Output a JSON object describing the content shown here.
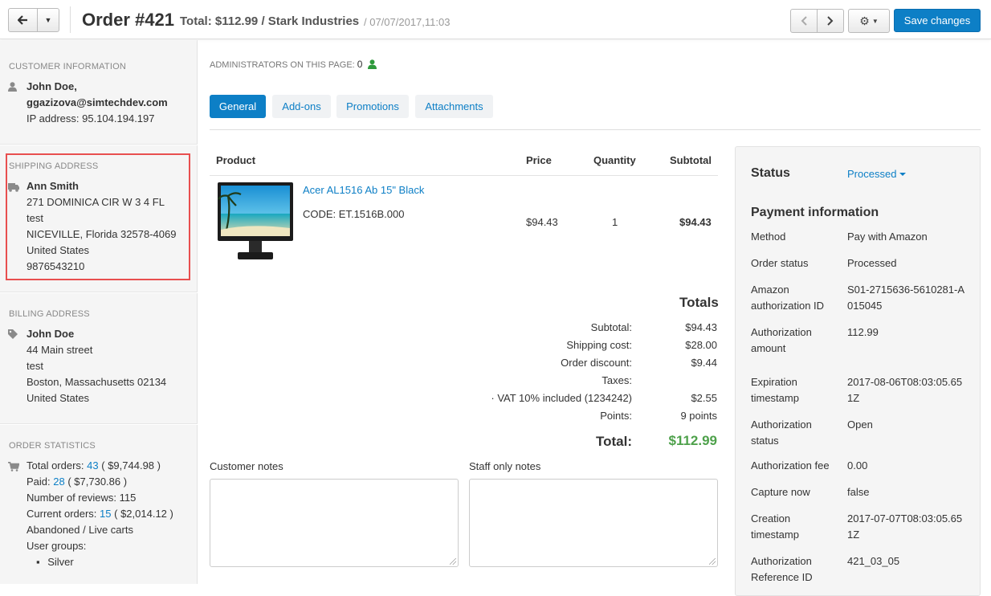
{
  "header": {
    "title": "Order #421",
    "subtitle": "Total: $112.99 / Stark Industries",
    "date": "/ 07/07/2017,11:03",
    "save_label": "Save changes"
  },
  "sidebar": {
    "customer": {
      "title": "Customer Information",
      "name": "John Doe,",
      "email": "ggazizova@simtechdev.com",
      "ip": "IP address: 95.104.194.197"
    },
    "shipping": {
      "title": "Shipping Address",
      "name": "Ann Smith",
      "line1": "271 DOMINICA CIR W 3 4 FL",
      "line2": "test",
      "line3": "NICEVILLE, Florida 32578-4069",
      "line4": "United States",
      "phone": "9876543210"
    },
    "billing": {
      "title": "Billing Address",
      "name": "John Doe",
      "line1": "44 Main street",
      "line2": "test",
      "line3": "Boston, Massachusetts 02134",
      "line4": "United States"
    },
    "stats": {
      "title": "Order Statistics",
      "total_orders_label": "Total orders:",
      "total_orders_count": "43",
      "total_orders_amount": "( $9,744.98 )",
      "paid_label": "Paid:",
      "paid_count": "28",
      "paid_amount": "( $7,730.86 )",
      "reviews": "Number of reviews: 115",
      "current_label": "Current orders:",
      "current_count": "15",
      "current_amount": "( $2,014.12 )",
      "abandoned_link": "Abandoned / Live carts",
      "user_groups_label": "User groups:",
      "user_group": "Silver"
    }
  },
  "main": {
    "admins_label": "ADMINISTRATORS ON THIS PAGE:",
    "admins_count": "0",
    "tabs": [
      "General",
      "Add-ons",
      "Promotions",
      "Attachments"
    ],
    "columns": [
      "Product",
      "Price",
      "Quantity",
      "Subtotal"
    ],
    "product": {
      "name": "Acer AL1516 Ab 15\" Black",
      "code": "CODE: ET.1516B.000",
      "price": "$94.43",
      "quantity": "1",
      "subtotal": "$94.43"
    },
    "totals": {
      "title": "Totals",
      "rows": [
        {
          "label": "Subtotal:",
          "value": "$94.43"
        },
        {
          "label": "Shipping cost:",
          "value": "$28.00"
        },
        {
          "label": "Order discount:",
          "value": "$9.44"
        },
        {
          "label": "Taxes:",
          "value": ""
        },
        {
          "label": "· VAT 10% included (1234242)",
          "value": "$2.55"
        },
        {
          "label": "Points:",
          "value": "9 points"
        }
      ],
      "total_label": "Total:",
      "total_value": "$112.99"
    },
    "customer_notes_label": "Customer notes",
    "staff_notes_label": "Staff only notes"
  },
  "panel": {
    "status_title": "Status",
    "status_value": "Processed",
    "payment_title": "Payment information",
    "rows": [
      {
        "label": "Method",
        "value": "Pay with Amazon"
      },
      {
        "label": "Order status",
        "value": "Processed"
      },
      {
        "label": "Amazon authorization ID",
        "value": "S01-2715636-5610281-A015045"
      },
      {
        "label": "Authorization amount",
        "value": "112.99"
      },
      {
        "label": "Expiration timestamp",
        "value": "2017-08-06T08:03:05.651Z"
      },
      {
        "label": "Authorization status",
        "value": "Open"
      },
      {
        "label": "Authorization fee",
        "value": "0.00"
      },
      {
        "label": "Capture now",
        "value": "false"
      },
      {
        "label": "Creation timestamp",
        "value": "2017-07-07T08:03:05.651Z"
      },
      {
        "label": "Authorization Reference ID",
        "value": "421_03_05"
      }
    ]
  },
  "colors": {
    "accent": "#0d7fc6",
    "total_green": "#4ea14b",
    "highlight_red": "#e84f4f"
  }
}
